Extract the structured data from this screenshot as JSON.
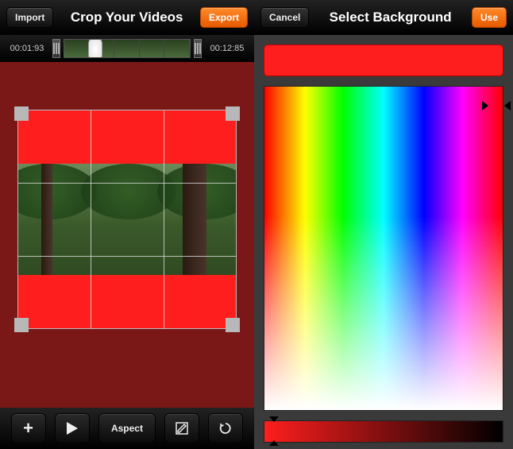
{
  "left": {
    "import_label": "Import",
    "title": "Crop Your Videos",
    "export_label": "Export",
    "time_start": "00:01:93",
    "time_end": "00:12:85",
    "toolbar": {
      "aspect_label": "Aspect"
    },
    "accent_color": "#ff1e1e"
  },
  "right": {
    "cancel_label": "Cancel",
    "title": "Select Background",
    "use_label": "Use",
    "selected_color": "#ff1e1e"
  }
}
